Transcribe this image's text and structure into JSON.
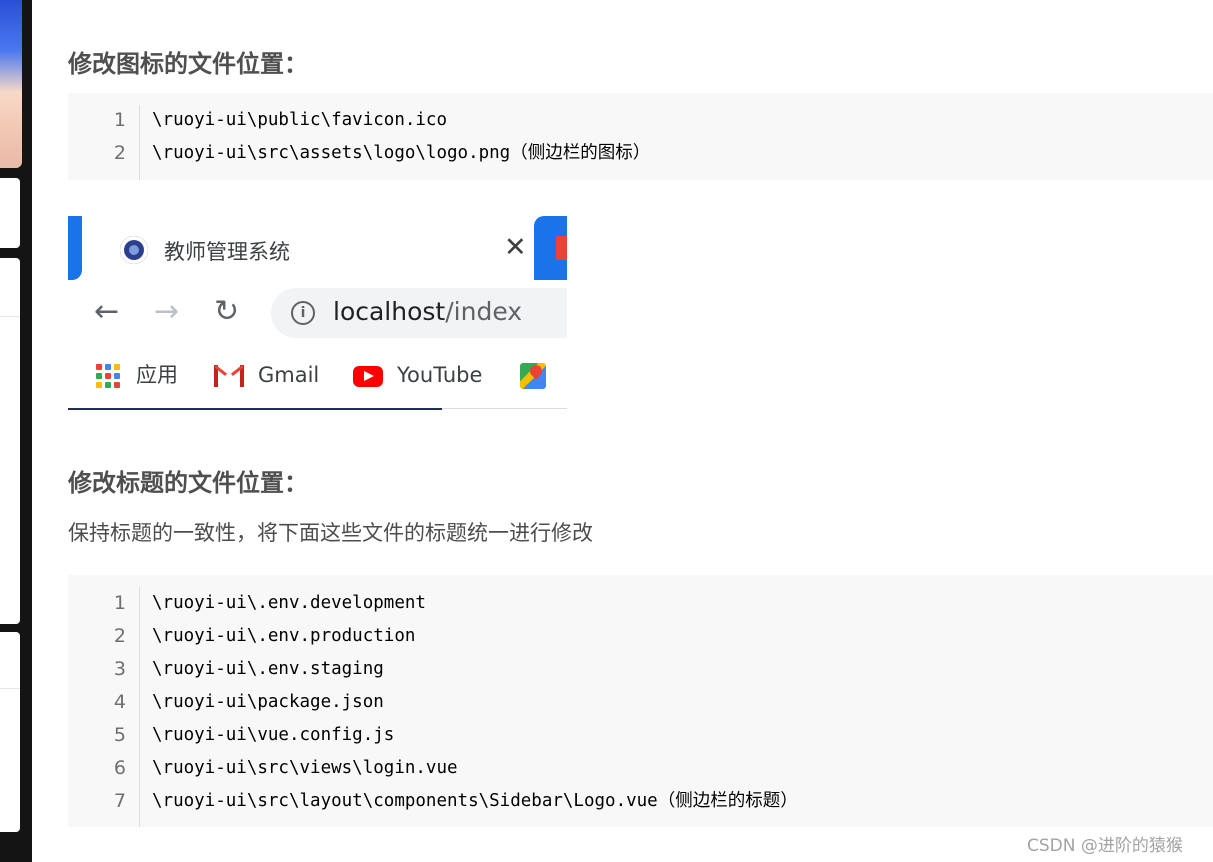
{
  "sections": [
    {
      "heading": "修改图标的文件位置：",
      "code_lines": [
        {
          "num": "1",
          "code": "\\ruoyi-ui\\public\\favicon.ico"
        },
        {
          "num": "2",
          "code": "\\ruoyi-ui\\src\\assets\\logo\\logo.png（侧边栏的图标）"
        }
      ]
    },
    {
      "heading": "修改标题的文件位置：",
      "paragraph": "保持标题的一致性，将下面这些文件的标题统一进行修改",
      "code_lines": [
        {
          "num": "1",
          "code": "\\ruoyi-ui\\.env.development"
        },
        {
          "num": "2",
          "code": "\\ruoyi-ui\\.env.production"
        },
        {
          "num": "3",
          "code": "\\ruoyi-ui\\.env.staging"
        },
        {
          "num": "4",
          "code": "\\ruoyi-ui\\package.json"
        },
        {
          "num": "5",
          "code": "\\ruoyi-ui\\vue.config.js"
        },
        {
          "num": "6",
          "code": "\\ruoyi-ui\\src\\views\\login.vue"
        },
        {
          "num": "7",
          "code": "\\ruoyi-ui\\src\\layout\\components\\Sidebar\\Logo.vue（侧边栏的标题）"
        }
      ]
    }
  ],
  "browser_screenshot": {
    "tab_title": "教师管理系统",
    "tab_close": "✕",
    "back": "←",
    "forward": "→",
    "reload": "↻",
    "info": "i",
    "url_host": "localhost",
    "url_path": "/index",
    "bookmarks": {
      "apps": "应用",
      "gmail": "Gmail",
      "youtube": "YouTube"
    },
    "icons": [
      "app-favicon-icon",
      "back-arrow-icon",
      "forward-arrow-icon",
      "reload-icon",
      "info-icon",
      "apps-grid-icon",
      "gmail-icon",
      "youtube-icon",
      "maps-icon"
    ],
    "colors": {
      "tab_accent": "#1a73e8",
      "youtube": "#ff0000",
      "gmail": "#ea4335"
    }
  },
  "watermark": "CSDN @进阶的猿猴"
}
